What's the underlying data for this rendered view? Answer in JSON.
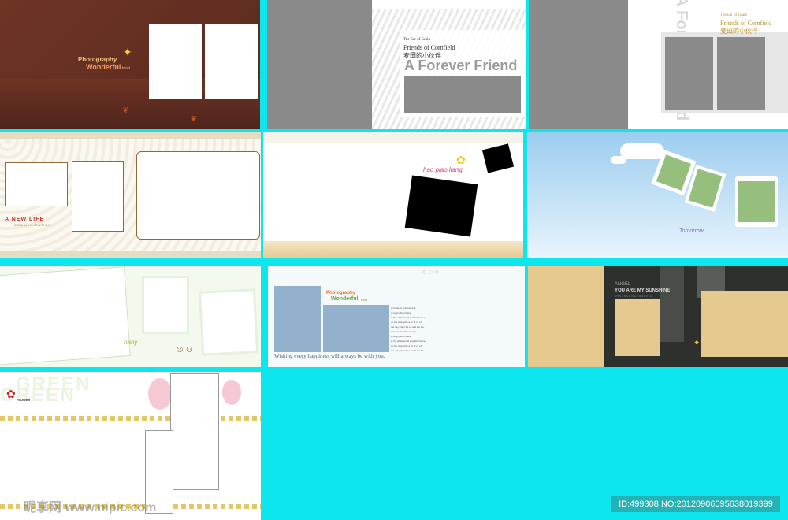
{
  "colors": {
    "background": "#0ee6ee",
    "brown_bg": "#6b3224",
    "placeholder_gray": "#8a8a8a",
    "sky_blue": "#9ccdef",
    "tan": "#e6c98f",
    "dark_panel": "#2e302d",
    "frame_green": "#96bf7e",
    "steel_blue": "#93b0cc"
  },
  "tiles": {
    "t1": {
      "line1": "Photography",
      "line2": "Wonderful",
      "tag": "treat"
    },
    "t2": {
      "brand_small": "The Ear of Grain",
      "brand": "Friends of Cornfield",
      "brand_cn": "麦田的小伙伴",
      "headline": "A Forever Friend"
    },
    "t3": {
      "vertical": "A Forever Friend",
      "brand_small": "The Ear of Grain",
      "brand": "Friends of Cornfield",
      "brand_cn": "麦田的小伙伴"
    },
    "t4": {
      "title": "A NEW LIFE",
      "subtitle": "COMMUNICATION"
    },
    "t5": {
      "tagline": "hao piao liang"
    },
    "t6": {
      "tagline": "Tomorrow"
    },
    "t7": {
      "tagline": "baby"
    },
    "t8": {
      "line1": "Photography",
      "line2": "Wonderful",
      "tag": "treat",
      "caption": "Wishing every happiness will always be with you.",
      "poem": [
        "A house of a flower and",
        "A puppy then there",
        "in the white small wooden house,",
        "on the lawn with a lot of oil of",
        "the day when It's sit and the life.",
        "A house of a flower and",
        "A puppy then there",
        "in the white small wooden house,",
        "on the lawn with a lot of oil of",
        "the day when It's sit and the life."
      ]
    },
    "t9": {
      "small": "ANGEL",
      "title": "YOU ARE MY SUNSHINE",
      "sub": "M Y  S U N S H I N E  F O R E V E R"
    },
    "t10": {
      "big1": "GREEN",
      "big2": "GREEN",
      "label": "FLOWER"
    }
  },
  "watermark": {
    "site": "昵享网 www.nipic.com",
    "id": "ID:499308 NO:20120906095638019399"
  }
}
